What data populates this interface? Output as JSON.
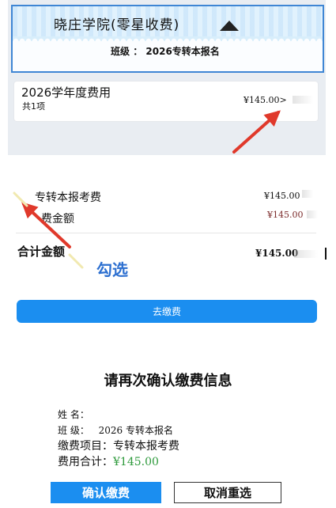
{
  "header": {
    "school_name": "晓庄学院(零星收费)",
    "class_label": "班级",
    "class_sep": "：",
    "class_value": "2026专转本报名"
  },
  "fee_card": {
    "title": "2026学年度费用",
    "count": "共1项",
    "amount": "¥145.00",
    "chevron": ">"
  },
  "items": [
    {
      "label": "专转本报考费",
      "amount": "¥145.00"
    },
    {
      "label": "费金额",
      "amount": "¥145.00"
    }
  ],
  "total": {
    "label": "合计金额",
    "amount": "¥145.00"
  },
  "annotation": "勾选",
  "pay_button": "去缴费",
  "confirm": {
    "title": "请再次确认缴费信息",
    "name_label": "姓 名：",
    "class_label": "班 级：",
    "class_value": "2026 专转本报名",
    "item_label": "缴费项目：",
    "item_value": "专转本报考费",
    "total_label": "费用合计：",
    "total_value": "¥145.00",
    "confirm_button": "确认缴费",
    "cancel_button": "取消重选"
  },
  "colors": {
    "accent": "#1b8ef0",
    "arrow": "#e0392b",
    "green": "#2e9a3c",
    "annotation": "#2c6fd0"
  }
}
